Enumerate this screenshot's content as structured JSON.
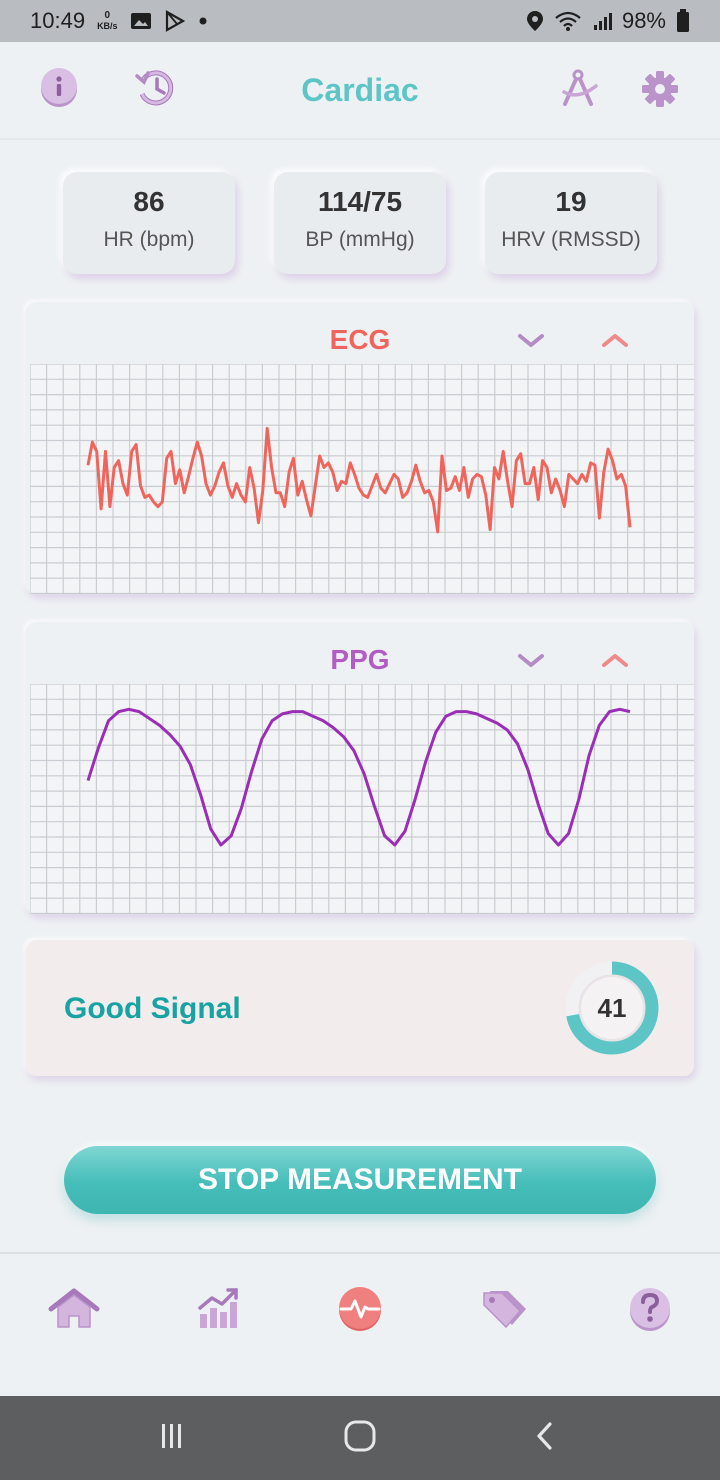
{
  "status_bar": {
    "time": "10:49",
    "net_speed_value": "0",
    "net_speed_unit": "KB/s",
    "battery": "98%"
  },
  "app_bar": {
    "title": "Cardiac"
  },
  "metrics": [
    {
      "value": "86",
      "label": "HR (bpm)"
    },
    {
      "value": "114/75",
      "label": "BP (mmHg)"
    },
    {
      "value": "19",
      "label": "HRV (RMSSD)"
    }
  ],
  "ecg": {
    "title": "ECG",
    "color": "#f0655b",
    "signal": [
      0.56,
      0.66,
      0.62,
      0.37,
      0.62,
      0.38,
      0.55,
      0.58,
      0.48,
      0.43,
      0.62,
      0.65,
      0.47,
      0.42,
      0.43,
      0.4,
      0.38,
      0.4,
      0.59,
      0.62,
      0.48,
      0.54,
      0.44,
      0.51,
      0.59,
      0.66,
      0.6,
      0.48,
      0.43,
      0.47,
      0.53,
      0.57,
      0.47,
      0.42,
      0.48,
      0.43,
      0.4,
      0.55,
      0.46,
      0.31,
      0.45,
      0.72,
      0.55,
      0.44,
      0.44,
      0.38,
      0.53,
      0.59,
      0.43,
      0.49,
      0.41,
      0.34,
      0.47,
      0.6,
      0.55,
      0.57,
      0.53,
      0.45,
      0.49,
      0.48,
      0.57,
      0.52,
      0.46,
      0.43,
      0.42,
      0.47,
      0.52,
      0.46,
      0.44,
      0.48,
      0.52,
      0.5,
      0.42,
      0.44,
      0.49,
      0.56,
      0.49,
      0.44,
      0.45,
      0.4,
      0.27,
      0.6,
      0.45,
      0.46,
      0.51,
      0.45,
      0.55,
      0.42,
      0.5,
      0.52,
      0.51,
      0.43,
      0.28,
      0.55,
      0.5,
      0.62,
      0.49,
      0.38,
      0.58,
      0.61,
      0.48,
      0.48,
      0.55,
      0.41,
      0.58,
      0.55,
      0.44,
      0.5,
      0.45,
      0.38,
      0.52,
      0.5,
      0.48,
      0.52,
      0.49,
      0.57,
      0.56,
      0.33,
      0.53,
      0.63,
      0.58,
      0.5,
      0.52,
      0.47,
      0.29
    ]
  },
  "ppg": {
    "title": "PPG",
    "color": "#9a2eb6",
    "signal": [
      0.58,
      0.72,
      0.84,
      0.88,
      0.89,
      0.88,
      0.85,
      0.82,
      0.78,
      0.73,
      0.65,
      0.52,
      0.37,
      0.3,
      0.34,
      0.46,
      0.62,
      0.76,
      0.84,
      0.87,
      0.88,
      0.88,
      0.86,
      0.84,
      0.81,
      0.77,
      0.71,
      0.61,
      0.47,
      0.34,
      0.3,
      0.36,
      0.5,
      0.66,
      0.79,
      0.86,
      0.88,
      0.88,
      0.87,
      0.85,
      0.83,
      0.8,
      0.74,
      0.63,
      0.48,
      0.35,
      0.3,
      0.35,
      0.5,
      0.69,
      0.82,
      0.88,
      0.89,
      0.88
    ]
  },
  "signal_quality": {
    "label": "Good Signal",
    "score": "41",
    "ring_fraction": 0.72
  },
  "actions": {
    "stop_label": "STOP MEASUREMENT"
  },
  "bottom_nav": [
    {
      "name": "home",
      "active": false
    },
    {
      "name": "statistics",
      "active": false
    },
    {
      "name": "measure",
      "active": true
    },
    {
      "name": "tags",
      "active": false
    },
    {
      "name": "help",
      "active": false
    }
  ],
  "colors": {
    "accent_teal": "#5ec5c7",
    "icon_purple": "#c9a6d6",
    "active_coral": "#f07f7f",
    "ecg_line": "#f0655b",
    "ppg_line": "#9a2eb6"
  }
}
